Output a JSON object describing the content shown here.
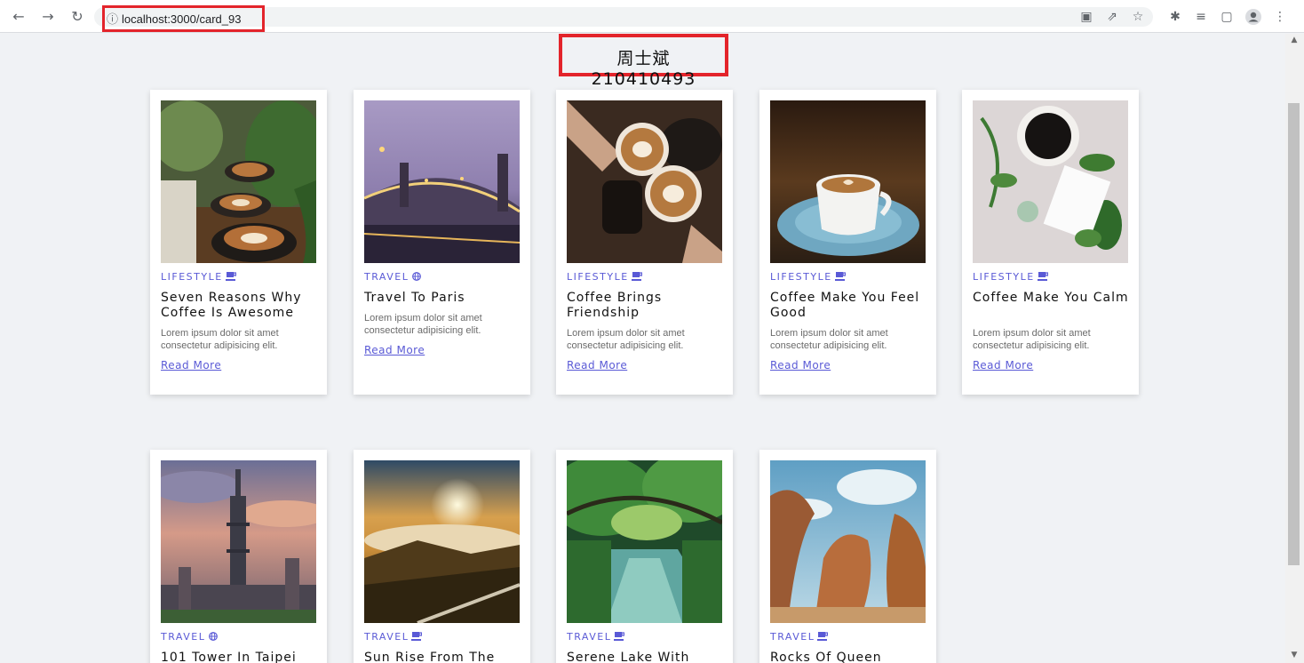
{
  "browser": {
    "url": "localhost:3000/card_93"
  },
  "page": {
    "heading": "周士斌 210410493"
  },
  "colors": {
    "accent": "#5a5ad6",
    "highlight": "#e3242b"
  },
  "cards": [
    {
      "category": "LIFESTYLE",
      "category_icon": "coffee-icon",
      "title": "Seven Reasons Why Coffee Is Awesome",
      "description": "Lorem ipsum dolor sit amet consectetur adipisicing elit.",
      "link": "Read More"
    },
    {
      "category": "TRAVEL",
      "category_icon": "globe-icon",
      "title": "Travel To Paris",
      "description": "Lorem ipsum dolor sit amet consectetur adipisicing elit.",
      "link": "Read More"
    },
    {
      "category": "LIFESTYLE",
      "category_icon": "coffee-icon",
      "title": "Coffee Brings Friendship",
      "description": "Lorem ipsum dolor sit amet consectetur adipisicing elit.",
      "link": "Read More"
    },
    {
      "category": "LIFESTYLE",
      "category_icon": "coffee-icon",
      "title": "Coffee Make You Feel Good",
      "description": "Lorem ipsum dolor sit amet consectetur adipisicing elit.",
      "link": "Read More"
    },
    {
      "category": "LIFESTYLE",
      "category_icon": "coffee-icon",
      "title": "Coffee Make You Calm",
      "description": "Lorem ipsum dolor sit amet consectetur adipisicing elit.",
      "link": "Read More"
    },
    {
      "category": "TRAVEL",
      "category_icon": "globe-icon",
      "title": "101 Tower In Taipei"
    },
    {
      "category": "TRAVEL",
      "category_icon": "coffee-icon",
      "title": "Sun Rise From The"
    },
    {
      "category": "TRAVEL",
      "category_icon": "coffee-icon",
      "title": "Serene Lake With"
    },
    {
      "category": "TRAVEL",
      "category_icon": "coffee-icon",
      "title": "Rocks Of Queen"
    }
  ]
}
